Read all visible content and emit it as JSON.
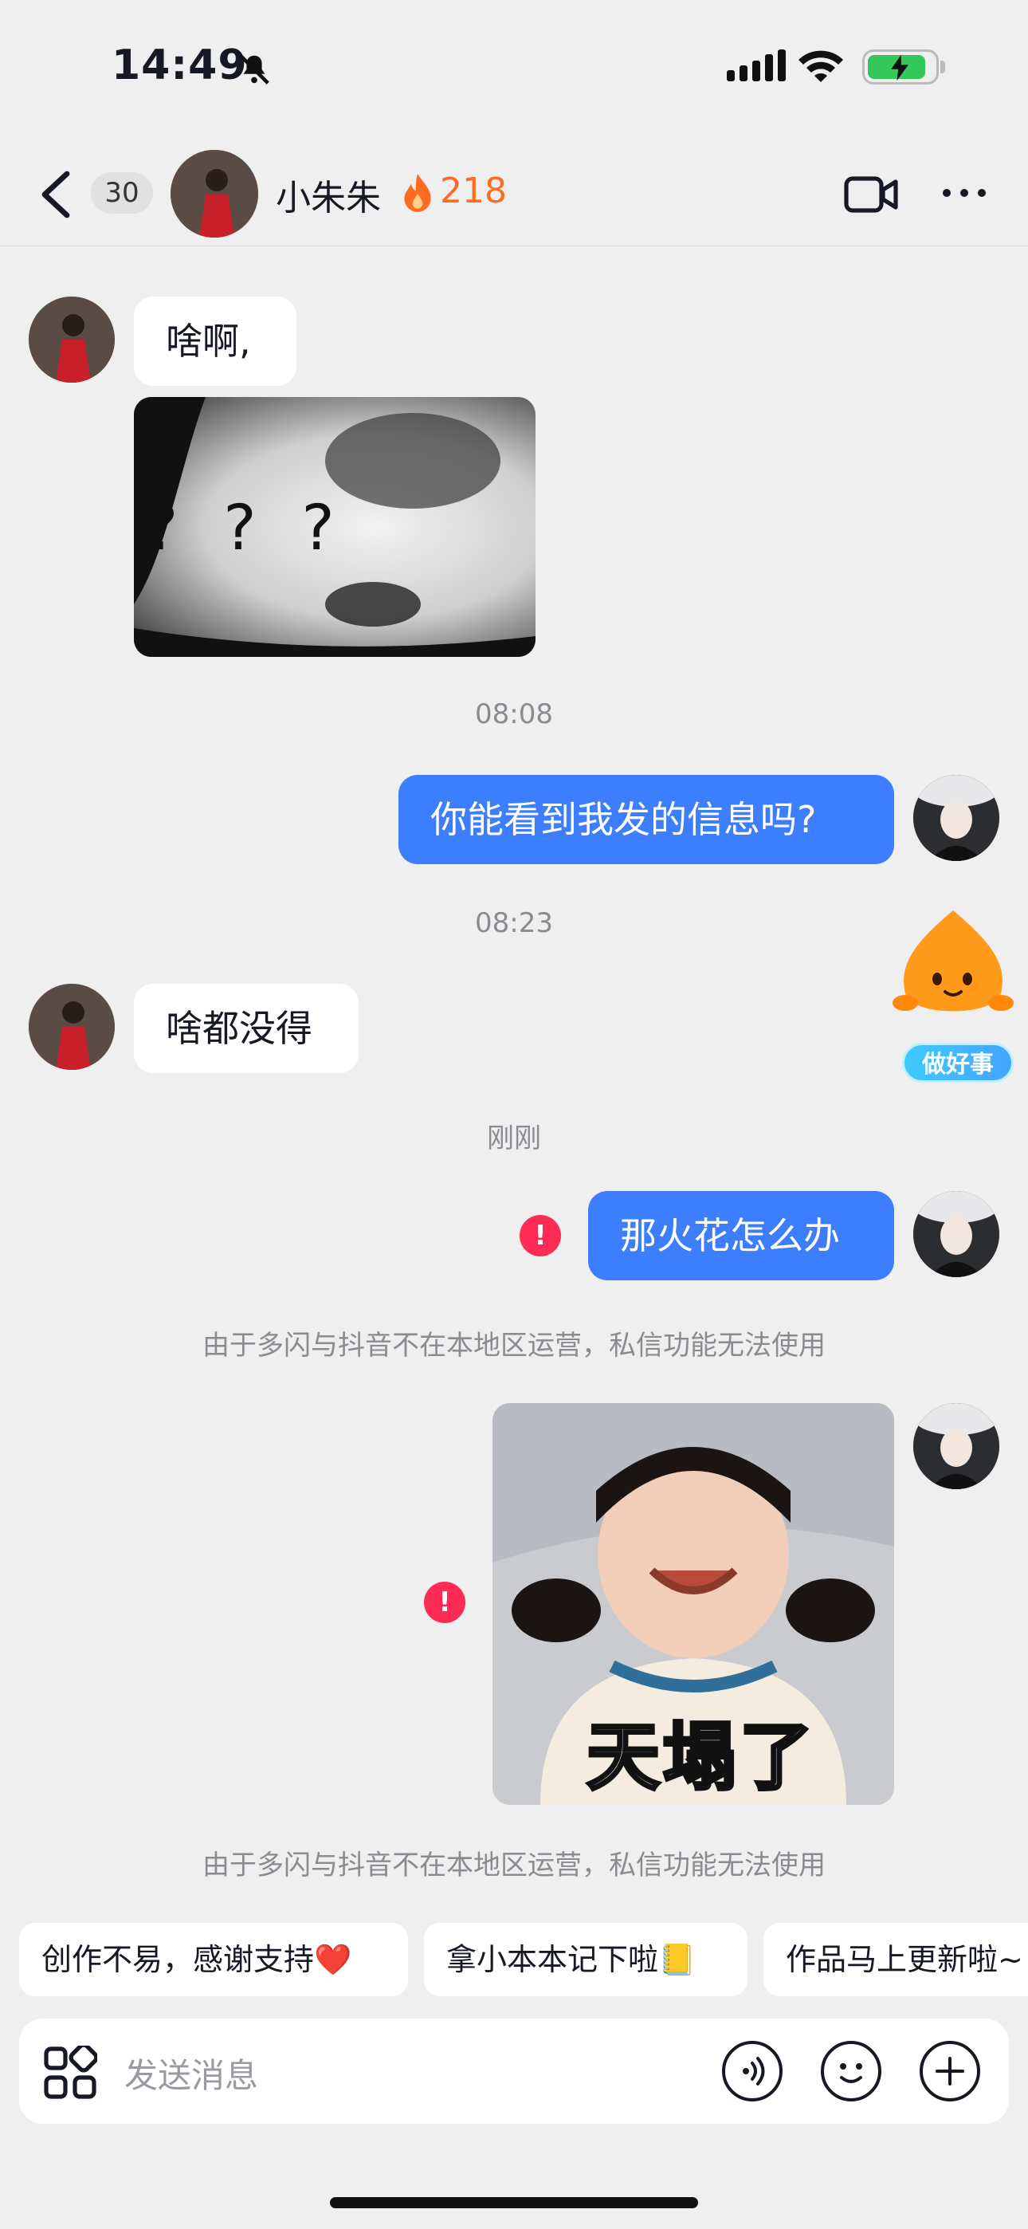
{
  "status_bar": {
    "time": "14:49"
  },
  "header": {
    "unread_count": "30",
    "contact_name": "小朱朱",
    "streak_count": "218"
  },
  "messages": {
    "m1_text": "啥啊,",
    "m2_sticker_text": "? ? ?",
    "t1": "08:08",
    "m3_text": "你能看到我发的信息吗?",
    "t2": "08:23",
    "m4_text": "啥都没得",
    "t3": "刚刚",
    "m5_text": "那火花怎么办",
    "notice1": "由于多闪与抖音不在本地区运营，私信功能无法使用",
    "m6_sticker_caption": "天塌了",
    "notice2": "由于多闪与抖音不在本地区运营，私信功能无法使用",
    "error_mark": "!"
  },
  "mascot": {
    "tag": "做好事"
  },
  "quick_replies": [
    {
      "label": "创作不易，感谢支持❤️"
    },
    {
      "label": "拿小本本记下啦📒"
    },
    {
      "label": "作品马上更新啦~"
    }
  ],
  "input": {
    "placeholder": "发送消息"
  },
  "colors": {
    "accent_blue": "#3d7eff",
    "error_red": "#fe2c55",
    "streak_orange": "#fe6b22",
    "background": "#efefef"
  }
}
